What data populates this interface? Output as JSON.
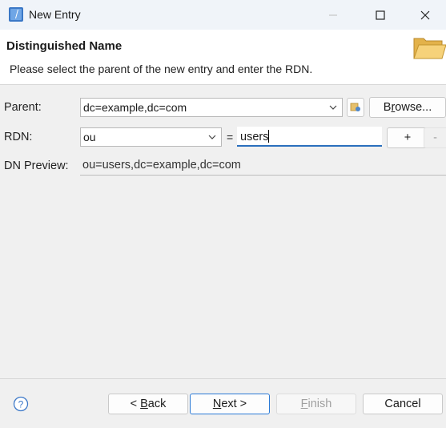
{
  "window": {
    "title": "New Entry",
    "icons": {
      "app": "ldap-entry-icon",
      "minimize": "minimize-icon",
      "maximize": "maximize-icon",
      "close": "close-icon"
    }
  },
  "header": {
    "title": "Distinguished Name",
    "description": "Please select the parent of the new entry and enter the RDN.",
    "icon": "folder-icon"
  },
  "form": {
    "parent_label": "Parent:",
    "parent_value": "dc=example,dc=com",
    "browse_label_pre": "B",
    "browse_mnemonic": "r",
    "browse_label_post": "owse...",
    "rdn_label": "RDN:",
    "rdn_attribute": "ou",
    "equals": "=",
    "rdn_value": "users",
    "add_label": "+",
    "remove_label": "-",
    "preview_label": "DN Preview:",
    "preview_value": "ou=users,dc=example,dc=com"
  },
  "footer": {
    "back_pre": "< ",
    "back_mnemonic": "B",
    "back_post": "ack",
    "next_mnemonic": "N",
    "next_post": "ext >",
    "finish_mnemonic": "F",
    "finish_post": "inish",
    "cancel_label": "Cancel",
    "help_icon": "help-icon"
  },
  "colors": {
    "accent": "#2b6fbd",
    "header_bg": "#ffffff",
    "dialog_bg": "#f0f0f0"
  }
}
